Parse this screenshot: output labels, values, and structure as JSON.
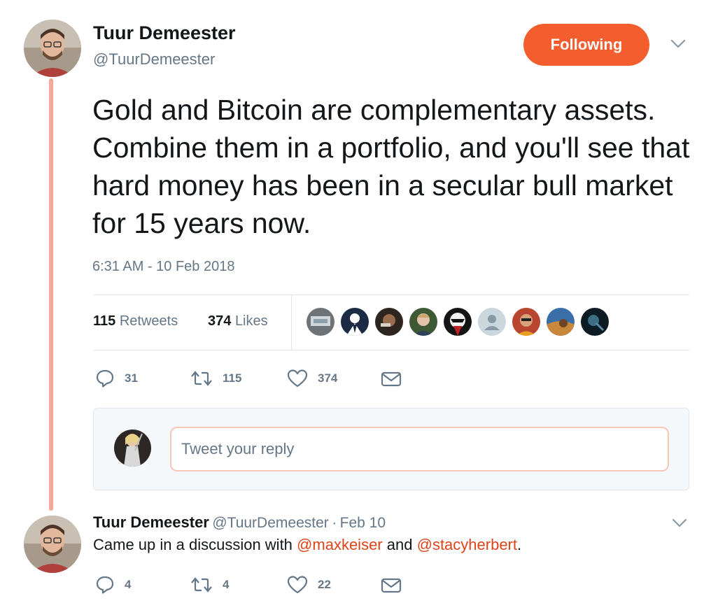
{
  "tweet": {
    "author_name": "Tuur Demeester",
    "author_handle": "@TuurDemeester",
    "follow_label": "Following",
    "text": "Gold and Bitcoin are complementary assets. Combine them in a portfolio, and you'll see that hard money has been in a secular bull market for 15 years now.",
    "timestamp": "6:31 AM - 10 Feb 2018",
    "stats": {
      "retweets_count": "115",
      "retweets_label": "Retweets",
      "likes_count": "374",
      "likes_label": "Likes"
    },
    "actions": {
      "reply_count": "31",
      "retweet_count": "115",
      "like_count": "374"
    },
    "accent_color": "#f45d2e"
  },
  "reply_composer": {
    "placeholder": "Tweet your reply"
  },
  "reply_tweet": {
    "author_name": "Tuur Demeester",
    "author_handle": "@TuurDemeester",
    "separator": "·",
    "date": "Feb 10",
    "text_before": "Came up in a discussion with",
    "mention1": "@maxkeiser",
    "text_middle": "and",
    "mention2": "@stacyherbert",
    "text_after": ".",
    "actions": {
      "reply_count": "4",
      "retweet_count": "4",
      "like_count": "22"
    }
  },
  "icons": [
    "reply-icon",
    "retweet-icon",
    "heart-icon",
    "envelope-icon",
    "chevron-down-icon"
  ]
}
